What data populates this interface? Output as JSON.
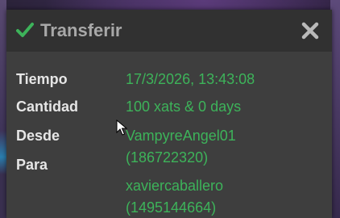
{
  "dialog": {
    "title": "Transferir",
    "rows": [
      {
        "label": "Tiempo",
        "value": "17/3/2026, 13:43:08"
      },
      {
        "label": "Cantidad",
        "value": "100 xats & 0 days"
      },
      {
        "label": "Desde",
        "value": "VampyreAngel01"
      },
      {
        "label": "Para",
        "value": "(186722320)"
      }
    ],
    "recipient_name": "xaviercaballero",
    "recipient_id": "(1495144664)"
  },
  "colors": {
    "accent_green": "#3db35a",
    "header_bg": "#313131",
    "body_bg": "#3e3e3e"
  },
  "icons": {
    "header": "check-icon",
    "close": "close-icon"
  }
}
